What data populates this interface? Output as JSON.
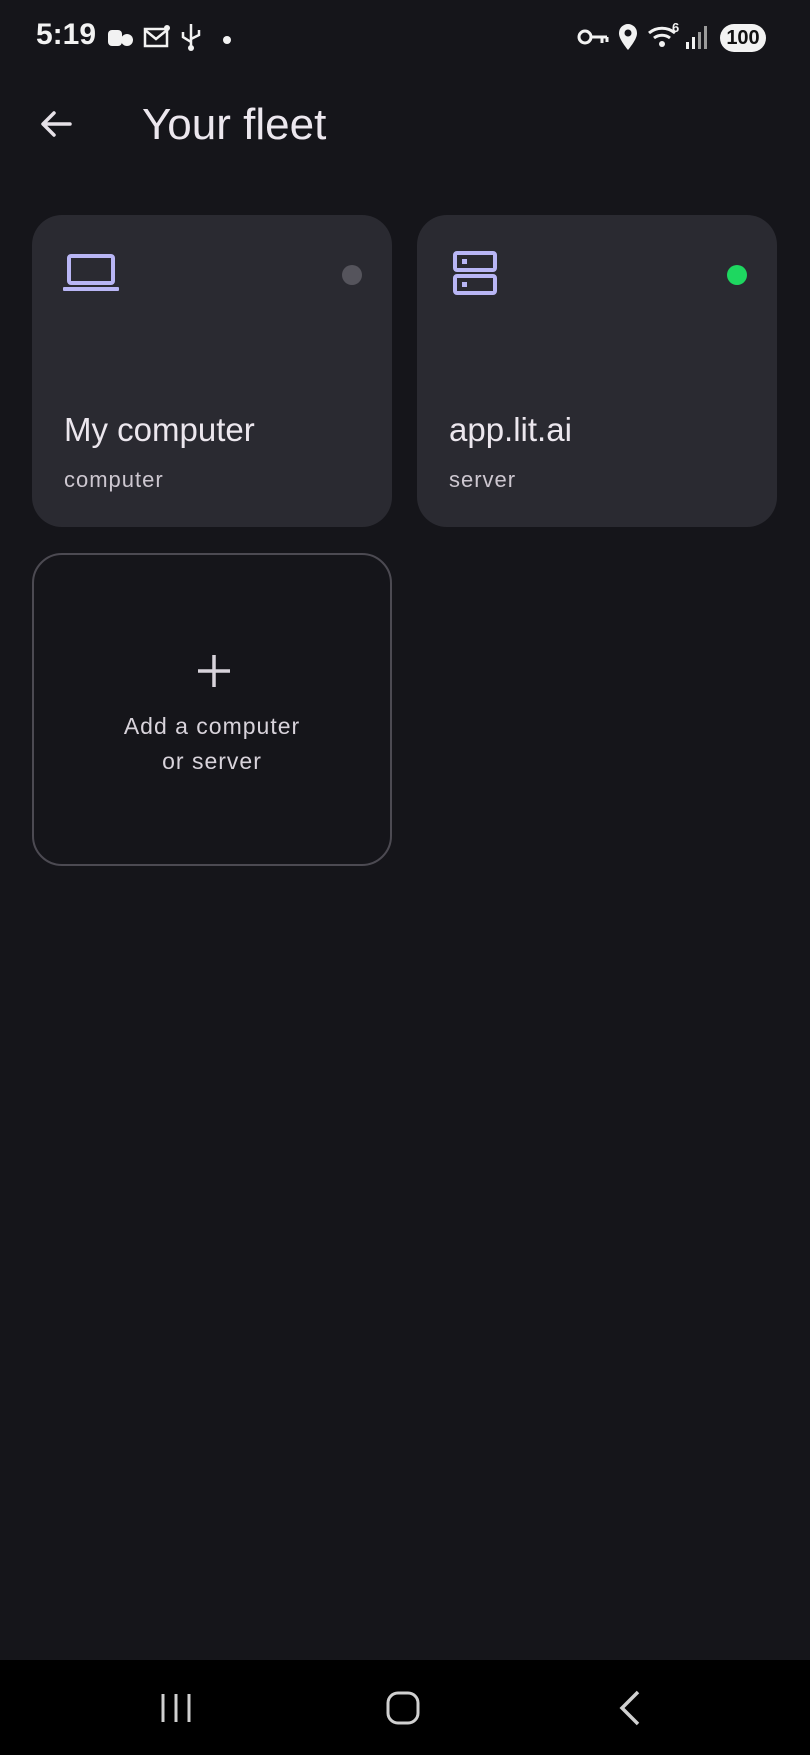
{
  "status_bar": {
    "time": "5:19",
    "battery_level": "100",
    "wifi_label": "6",
    "icons": [
      "carrier-icon",
      "mail-icon",
      "usb-icon",
      "dot-icon",
      "vpn-key-icon",
      "location-icon",
      "wifi-icon",
      "signal-icon"
    ]
  },
  "header": {
    "title": "Your fleet",
    "back_icon": "arrow-left-icon"
  },
  "fleet": [
    {
      "name": "My computer",
      "type": "computer",
      "icon": "laptop-icon",
      "status": "offline",
      "status_color": "#55545c",
      "icon_color": "#b9b6f5"
    },
    {
      "name": "app.lit.ai",
      "type": "server",
      "icon": "server-icon",
      "status": "online",
      "status_color": "#1ed760",
      "icon_color": "#b9b6f5"
    }
  ],
  "add_card": {
    "line1": "Add a computer",
    "line2": "or server",
    "icon": "plus-icon"
  },
  "nav": {
    "icons": [
      "recents-icon",
      "home-icon",
      "back-icon"
    ]
  }
}
